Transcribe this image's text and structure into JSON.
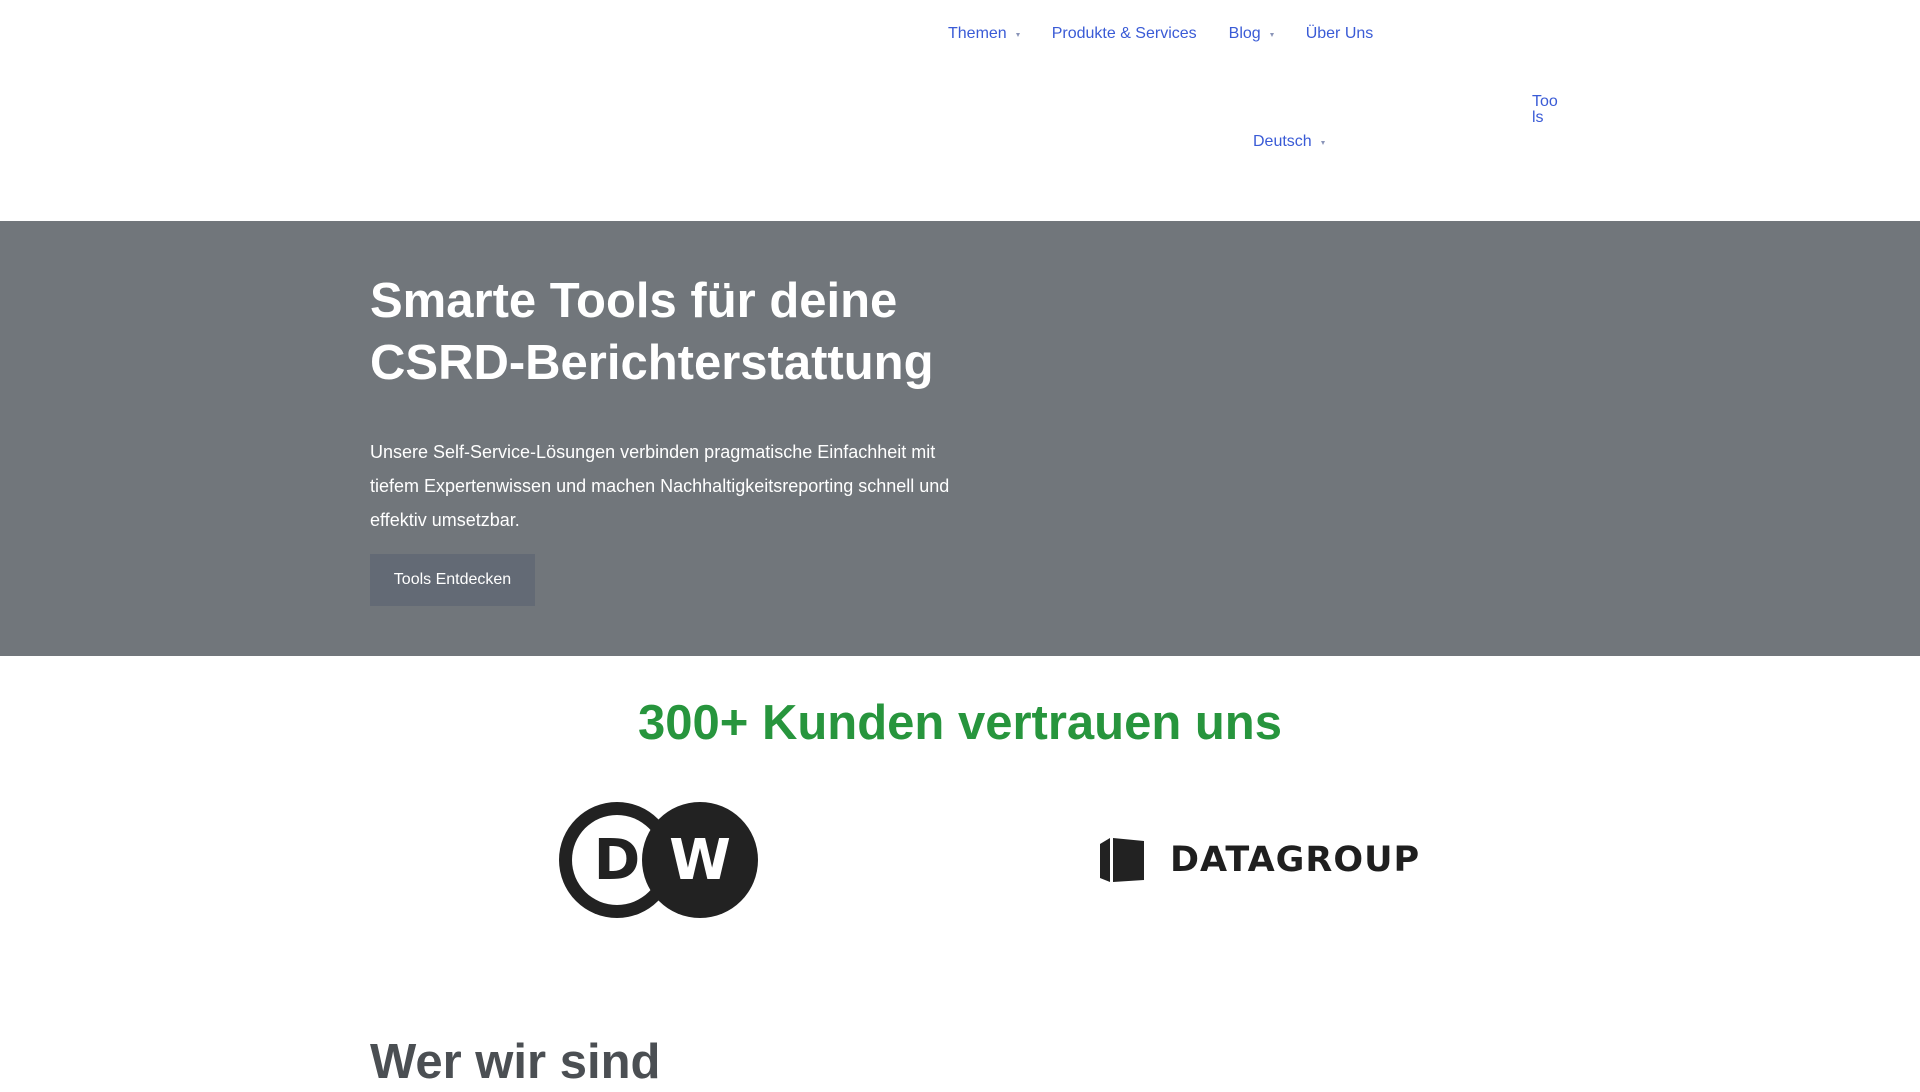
{
  "nav": {
    "items": [
      {
        "label": "Themen",
        "has_dropdown": true
      },
      {
        "label": "Produkte & Services",
        "has_dropdown": false
      },
      {
        "label": "Blog",
        "has_dropdown": true
      },
      {
        "label": "Über Uns",
        "has_dropdown": false
      }
    ],
    "language": {
      "label": "Deutsch",
      "has_dropdown": true
    },
    "tools_link": "Tools",
    "link_color": "#3a5bd6"
  },
  "hero": {
    "title_line1": "Smarte Tools für deine",
    "title_line2": "CSRD-Berichterstattung",
    "text": "Unsere Self-Service-Lösungen verbinden pragmatische Einfachheit mit tiefem Expertenwissen und machen Nachhaltigkeitsreporting schnell und effektiv umsetzbar.",
    "button_label": "Tools Entdecken",
    "background_color": "#71767b"
  },
  "customers": {
    "title": "300+ Kunden vertrauen uns",
    "title_color": "#27953d",
    "logos": [
      {
        "name": "DW",
        "letters": [
          "D",
          "W"
        ],
        "icon": "dw-logo-icon"
      },
      {
        "name": "DATAGROUP",
        "text": "DATAGROUP",
        "icon": "datagroup-cube-icon"
      }
    ]
  },
  "about": {
    "title": "Wer wir sind"
  }
}
